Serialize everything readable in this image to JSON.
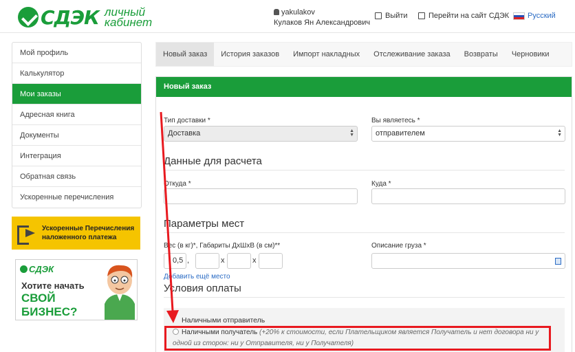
{
  "header": {
    "logo_text": "СДЭК",
    "logo_subtitle_line1": "личный",
    "logo_subtitle_line2": "кабинет",
    "username": "yakulakov",
    "full_name": "Кулаков Ян Александрович",
    "logout": "Выйти",
    "to_site": "Перейти на сайт СДЭК",
    "language": "Русский"
  },
  "sidebar": {
    "items": [
      {
        "label": "Мой профиль"
      },
      {
        "label": "Калькулятор"
      },
      {
        "label": "Мои заказы"
      },
      {
        "label": "Адресная книга"
      },
      {
        "label": "Документы"
      },
      {
        "label": "Интеграция"
      },
      {
        "label": "Обратная связь"
      },
      {
        "label": "Ускоренные перечисления"
      }
    ],
    "active_index": 2
  },
  "promo1": {
    "line1": "Ускоренные Перечисления",
    "line2": "наложенного платежа"
  },
  "promo2": {
    "logo": "СДЭК",
    "line1": "Хотите начать",
    "line2": "СВОЙ",
    "line3": "БИЗНЕС?"
  },
  "tabs": [
    {
      "label": "Новый заказ"
    },
    {
      "label": "История заказов"
    },
    {
      "label": "Импорт накладных"
    },
    {
      "label": "Отслеживание заказа"
    },
    {
      "label": "Возвраты"
    },
    {
      "label": "Черновики"
    }
  ],
  "panel": {
    "title": "Новый заказ",
    "delivery_type_label": "Тип доставки *",
    "delivery_type_value": "Доставка",
    "you_are_label": "Вы являетесь *",
    "you_are_value": "отправителем",
    "calc_heading": "Данные для расчета",
    "from_label": "Откуда *",
    "to_label": "Куда *",
    "places_heading": "Параметры мест",
    "weight_label": "Вес (в кг)*, Габариты ДхШхВ (в см)**",
    "weight_value": "0,5",
    "comma": ",",
    "x1": "x",
    "x2": "x",
    "desc_label": "Описание груза *",
    "add_place": "Добавить ещё место",
    "payment_heading": "Условия оплаты",
    "pay_option1": "Наличными отправитель",
    "pay_option2": "Наличными получатель",
    "pay_option2_note": "(+20% к стоимости, если Плательщиком является Получатель и нет договора ни у одной из сторон: ни у Отправителя, ни у Получателя)"
  },
  "colors": {
    "brand_green": "#1a9d3a",
    "highlight_red": "#e8191f",
    "link_blue": "#2a6bc4"
  }
}
